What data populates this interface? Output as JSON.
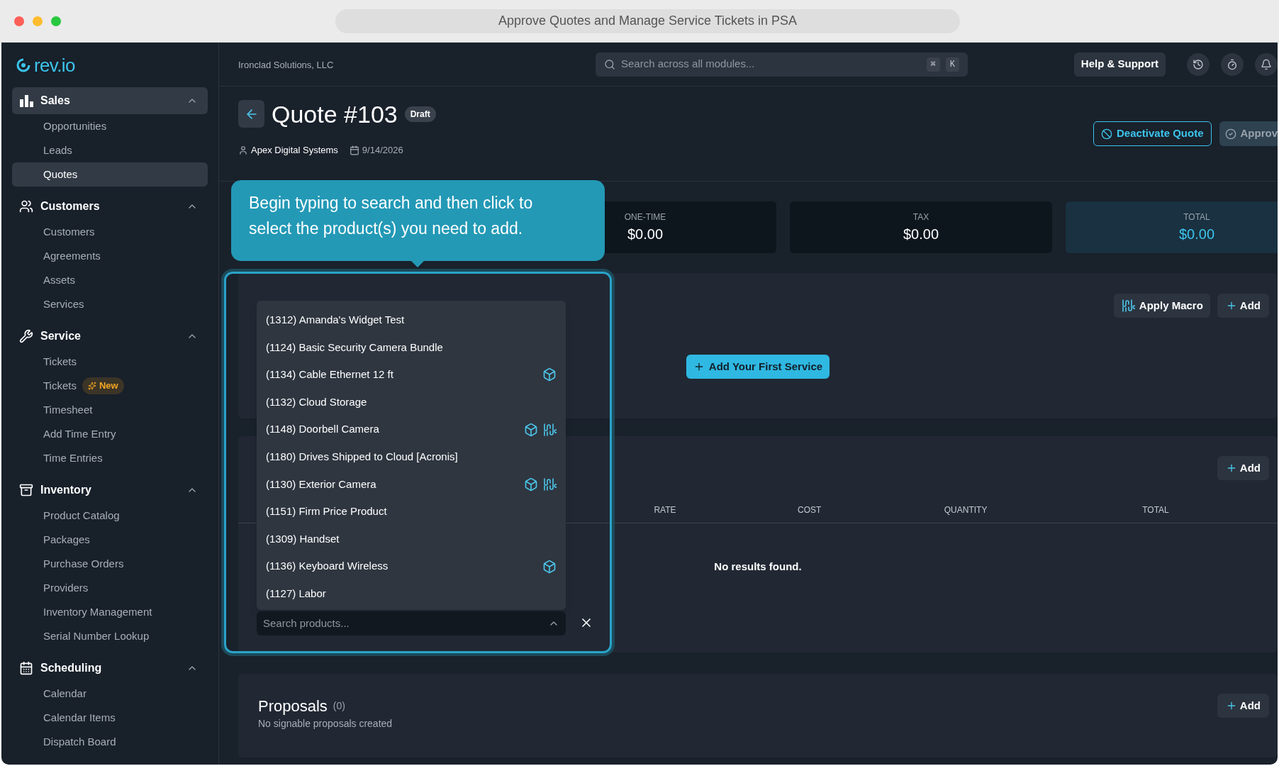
{
  "window": {
    "title": "Approve Quotes and Manage Service Tickets in PSA"
  },
  "sidebar": {
    "logo": "rev.io",
    "sections": [
      {
        "label": "Sales",
        "kind": "sales",
        "selected": true,
        "expanded": true,
        "items": [
          {
            "label": "Opportunities",
            "selected": false
          },
          {
            "label": "Leads",
            "selected": false
          },
          {
            "label": "Quotes",
            "selected": true
          }
        ]
      },
      {
        "label": "Customers",
        "kind": "customers",
        "selected": false,
        "expanded": true,
        "items": [
          {
            "label": "Customers",
            "selected": false
          },
          {
            "label": "Agreements",
            "selected": false
          },
          {
            "label": "Assets",
            "selected": false
          },
          {
            "label": "Services",
            "selected": false
          }
        ]
      },
      {
        "label": "Service",
        "kind": "service",
        "selected": false,
        "expanded": true,
        "items": [
          {
            "label": "Tickets",
            "selected": false
          },
          {
            "label": "Tickets",
            "selected": false,
            "badge": "New"
          },
          {
            "label": "Timesheet",
            "selected": false
          },
          {
            "label": "Add Time Entry",
            "selected": false
          },
          {
            "label": "Time Entries",
            "selected": false
          }
        ]
      },
      {
        "label": "Inventory",
        "kind": "inventory",
        "selected": false,
        "expanded": true,
        "items": [
          {
            "label": "Product Catalog",
            "selected": false
          },
          {
            "label": "Packages",
            "selected": false
          },
          {
            "label": "Purchase Orders",
            "selected": false
          },
          {
            "label": "Providers",
            "selected": false
          },
          {
            "label": "Inventory Management",
            "selected": false
          },
          {
            "label": "Serial Number Lookup",
            "selected": false
          }
        ]
      },
      {
        "label": "Scheduling",
        "kind": "scheduling",
        "selected": false,
        "expanded": true,
        "items": [
          {
            "label": "Calendar",
            "selected": false
          },
          {
            "label": "Calendar Items",
            "selected": false
          },
          {
            "label": "Dispatch Board",
            "selected": false
          }
        ]
      }
    ]
  },
  "topbar": {
    "company": "Ironclad Solutions, LLC",
    "search": {
      "placeholder": "Search across all modules...",
      "keys": [
        "⌘",
        "K"
      ]
    },
    "help_button": "Help & Support"
  },
  "quote": {
    "title": "Quote #103",
    "status": "Draft",
    "customer": "Apex Digital Systems",
    "date": "9/14/2026",
    "actions": [
      {
        "label": "Deactivate Quote",
        "kind": "outline"
      },
      {
        "label": "Approv",
        "kind": "filled"
      }
    ]
  },
  "summary": [
    {
      "label": "ONE-TIME",
      "value": "$0.00",
      "highlighted": false
    },
    {
      "label": "TAX",
      "value": "$0.00",
      "highlighted": false
    },
    {
      "label": "TOTAL",
      "value": "$0.00",
      "highlighted": true
    }
  ],
  "products": {
    "buttons": [
      {
        "label": "Apply Macro",
        "kind": "macro"
      },
      {
        "label": "Add",
        "kind": "add"
      }
    ],
    "empty_button": "Add Your First Service"
  },
  "line_items": {
    "button": "Add",
    "columns": [
      "RATE",
      "COST",
      "QUANTITY",
      "TOTAL"
    ],
    "empty": "No results found."
  },
  "proposals": {
    "title": "Proposals",
    "count": "(0)",
    "empty": "No signable proposals created",
    "button": "Add"
  },
  "tooltip": {
    "text": "Begin typing to search and then click to select the product(s) you need to add."
  },
  "product_picker": {
    "options": [
      {
        "label": "(1312) Amanda's Widget Test",
        "inventory": false,
        "serialized": false
      },
      {
        "label": "(1124) Basic Security Camera Bundle",
        "inventory": false,
        "serialized": false
      },
      {
        "label": "(1134) Cable Ethernet 12 ft",
        "inventory": true,
        "serialized": false
      },
      {
        "label": "(1132) Cloud Storage",
        "inventory": false,
        "serialized": false
      },
      {
        "label": "(1148) Doorbell Camera",
        "inventory": true,
        "serialized": true
      },
      {
        "label": "(1180) Drives Shipped to Cloud [Acronis]",
        "inventory": false,
        "serialized": false
      },
      {
        "label": "(1130) Exterior Camera",
        "inventory": true,
        "serialized": true
      },
      {
        "label": "(1151) Firm Price Product",
        "inventory": false,
        "serialized": false
      },
      {
        "label": "(1309) Handset",
        "inventory": false,
        "serialized": false
      },
      {
        "label": "(1136) Keyboard Wireless",
        "inventory": true,
        "serialized": false
      },
      {
        "label": "(1127) Labor",
        "inventory": false,
        "serialized": false
      }
    ],
    "search": {
      "placeholder": "Search products...",
      "expanded": true
    }
  }
}
